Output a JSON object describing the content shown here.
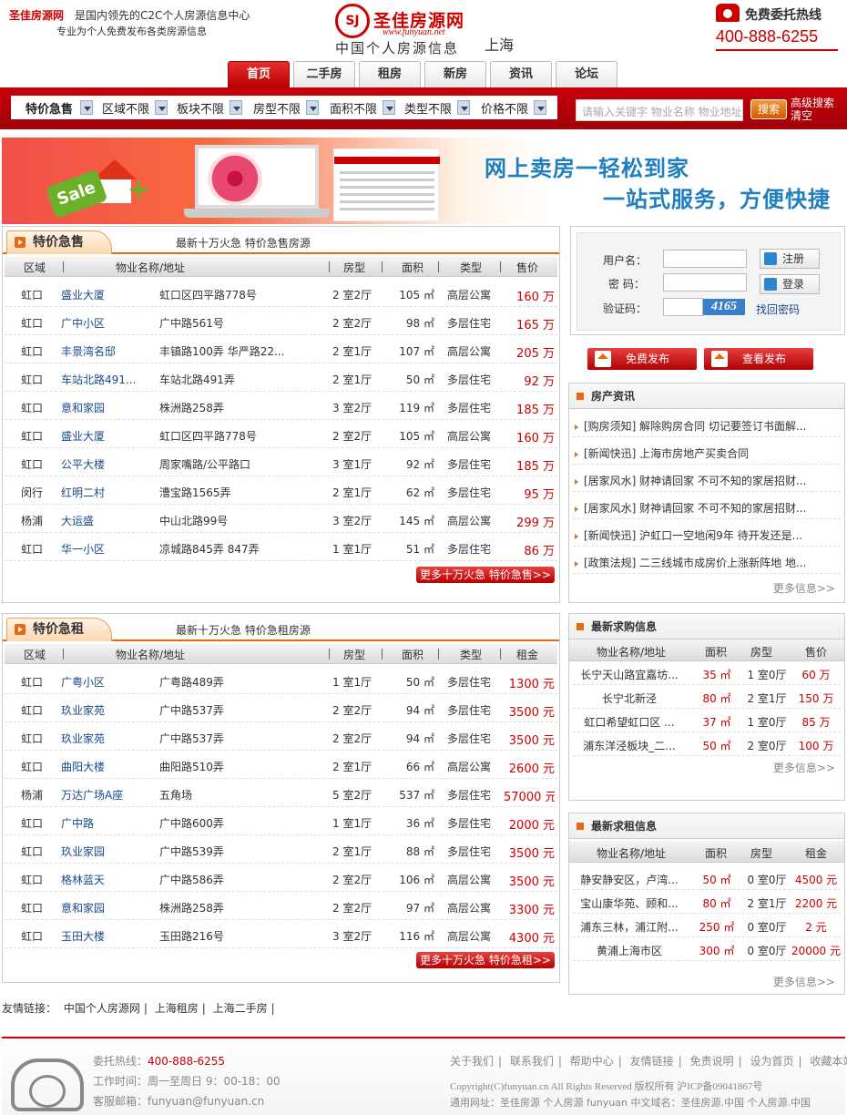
{
  "header": {
    "site_name": "圣佳房源网",
    "slogan1": "是国内领先的C2C个人房源信息中心",
    "slogan2": "专业为个人免费发布各类房源信息",
    "logo_mark": "SJ",
    "logo_cn": "圣佳房源网",
    "logo_url": "www.funyuan.net",
    "logo_sub": "中国个人房源信息",
    "city": "上海",
    "hotline_label": "免费委托热线",
    "hotline_number": "400-888-6255"
  },
  "nav": [
    "首页",
    "二手房",
    "租房",
    "新房",
    "资讯",
    "论坛"
  ],
  "search": {
    "filters": [
      "特价急售",
      "区域不限",
      "板块不限",
      "房型不限",
      "面积不限",
      "类型不限",
      "价格不限"
    ],
    "placeholder": "请输入关键字   物业名称  物业地址",
    "button": "搜索",
    "advanced": "高级搜索",
    "clear": "清空"
  },
  "banner": {
    "sale": "Sale",
    "line1": "网上卖房一轻松到家",
    "line2": "一站式服务，方便快捷"
  },
  "sale": {
    "title": "特价急售",
    "subtitle": "最新十万火急  特价急售房源",
    "headers": [
      "区域",
      "物业名称/地址",
      "房型",
      "面积",
      "类型",
      "售价"
    ],
    "rows": [
      [
        "虹口",
        "盛业大厦",
        "虹口区四平路778号",
        "2 室2厅",
        "105 ㎡",
        "高层公寓",
        "160 万"
      ],
      [
        "虹口",
        "广中小区",
        "广中路561号",
        "2 室2厅",
        "98 ㎡",
        "多层住宅",
        "165 万"
      ],
      [
        "虹口",
        "丰景湾名邸",
        "丰镇路100弄  华严路22...",
        "2 室1厅",
        "107 ㎡",
        "高层公寓",
        "205 万"
      ],
      [
        "虹口",
        "车站北路491...",
        "车站北路491弄",
        "2 室1厅",
        "50 ㎡",
        "多层住宅",
        "92 万"
      ],
      [
        "虹口",
        "意和家园",
        "株洲路258弄",
        "3 室2厅",
        "119 ㎡",
        "多层住宅",
        "185 万"
      ],
      [
        "虹口",
        "盛业大厦",
        "虹口区四平路778号",
        "2 室2厅",
        "105 ㎡",
        "高层公寓",
        "160 万"
      ],
      [
        "虹口",
        "公平大楼",
        "周家嘴路/公平路口",
        "3 室1厅",
        "92 ㎡",
        "多层住宅",
        "185 万"
      ],
      [
        "闵行",
        "红明二村",
        "漕宝路1565弄",
        "2 室1厅",
        "62 ㎡",
        "多层住宅",
        "95 万"
      ],
      [
        "杨浦",
        "大运盛",
        "中山北路99号",
        "3 室2厅",
        "145 ㎡",
        "高层公寓",
        "299 万"
      ],
      [
        "虹口",
        "华一小区",
        "凉城路845弄  847弄",
        "1 室1厅",
        "51 ㎡",
        "多层住宅",
        "86 万"
      ]
    ],
    "more": "更多十万火急  特价急售>>"
  },
  "rent": {
    "title": "特价急租",
    "subtitle": "最新十万火急  特价急租房源",
    "headers": [
      "区域",
      "物业名称/地址",
      "房型",
      "面积",
      "类型",
      "租金"
    ],
    "rows": [
      [
        "虹口",
        "广粤小区",
        "广粤路489弄",
        "1 室1厅",
        "50 ㎡",
        "多层住宅",
        "1300 元"
      ],
      [
        "虹口",
        "玖业家苑",
        "广中路537弄",
        "2 室2厅",
        "94 ㎡",
        "多层住宅",
        "3500 元"
      ],
      [
        "虹口",
        "玖业家苑",
        "广中路537弄",
        "2 室2厅",
        "94 ㎡",
        "多层住宅",
        "3500 元"
      ],
      [
        "虹口",
        "曲阳大楼",
        "曲阳路510弄",
        "2 室1厅",
        "66 ㎡",
        "高层公寓",
        "2600 元"
      ],
      [
        "杨浦",
        "万达广场A座",
        "五角场",
        "5 室2厅",
        "537 ㎡",
        "多层住宅",
        "57000 元"
      ],
      [
        "虹口",
        "广中路",
        "广中路600弄",
        "1 室1厅",
        "36 ㎡",
        "多层住宅",
        "2000 元"
      ],
      [
        "虹口",
        "玖业家园",
        "广中路539弄",
        "2 室1厅",
        "88 ㎡",
        "多层住宅",
        "3500 元"
      ],
      [
        "虹口",
        "格林蓝天",
        "广中路586弄",
        "2 室2厅",
        "106 ㎡",
        "高层公寓",
        "3500 元"
      ],
      [
        "虹口",
        "意和家园",
        "株洲路258弄",
        "2 室2厅",
        "97 ㎡",
        "高层公寓",
        "3300 元"
      ],
      [
        "虹口",
        "玉田大楼",
        "玉田路216号",
        "3 室2厅",
        "116 ㎡",
        "高层公寓",
        "4300 元"
      ]
    ],
    "more": "更多十万火急  特价急租>>"
  },
  "login": {
    "user_label": "用户名：",
    "pass_label": "密  码：",
    "code_label": "验证码：",
    "captcha": "4165",
    "register": "注册",
    "login": "登录",
    "forgot": "找回密码"
  },
  "publish": {
    "free": "免费发布",
    "view": "查看发布"
  },
  "news": {
    "title": "房产资讯",
    "items": [
      "[购房须知] 解除购房合同  切记要签订书面解...",
      "[新闻快迅] 上海市房地产买卖合同",
      "[居家风水] 财神请回家  不可不知的家居招财...",
      "[居家风水] 财神请回家  不可不知的家居招财...",
      "[新闻快迅] 沪虹口一空地闲9年  待开发还是...",
      "[政策法规] 二三线城市成房价上涨新阵地  地..."
    ],
    "more": "更多信息>>"
  },
  "buy": {
    "title": "最新求购信息",
    "headers": [
      "物业名称/地址",
      "面积",
      "房型",
      "售价"
    ],
    "rows": [
      [
        "长宁天山路宜嘉坊...",
        "35 ㎡",
        "1 室0厅",
        "60 万"
      ],
      [
        "长宁北新泾",
        "80 ㎡",
        "2 室1厅",
        "150 万"
      ],
      [
        "虹口希望虹口区  ...",
        "37 ㎡",
        "1 室0厅",
        "85 万"
      ],
      [
        "浦东洋泾板块_二...",
        "50 ㎡",
        "2 室0厅",
        "100 万"
      ]
    ],
    "more": "更多信息>>"
  },
  "seekrent": {
    "title": "最新求租信息",
    "headers": [
      "物业名称/地址",
      "面积",
      "房型",
      "租金"
    ],
    "rows": [
      [
        "静安静安区，卢湾...",
        "50 ㎡",
        "0 室0厅",
        "4500 元"
      ],
      [
        "宝山康华苑、顾和...",
        "80 ㎡",
        "2 室1厅",
        "2200 元"
      ],
      [
        "浦东三林，浦江附...",
        "250 ㎡",
        "0 室0厅",
        "2 元"
      ],
      [
        "黄浦上海市区",
        "300 ㎡",
        "0 室0厅",
        "20000 元"
      ]
    ],
    "more": "更多信息>>"
  },
  "friend_links": {
    "label": "友情链接：",
    "items": [
      "中国个人房源网",
      "上海租房",
      "上海二手房"
    ]
  },
  "footer": {
    "hotline": "委托热线：",
    "hotline_num": "400-888-6255",
    "hours": "工作时间：周一至周日  9：00-18：00",
    "email": "客服邮箱：funyuan@funyuan.cn",
    "links": [
      "关于我们",
      "联系我们",
      "帮助中心",
      "友情链接",
      "免责说明",
      "设为首页",
      "收藏本站"
    ],
    "copyright": "Copyright(C)funyuan.cn All Rights Reserved 版权所有  沪ICP备09041867号",
    "general": "通用网址：圣佳房源  个人房源  funyuan 中文域名：圣佳房源.中国  个人房源.中国"
  },
  "colors": {
    "brand": "#cc0000",
    "accent": "#e86a10",
    "link": "#1a4a8a"
  }
}
